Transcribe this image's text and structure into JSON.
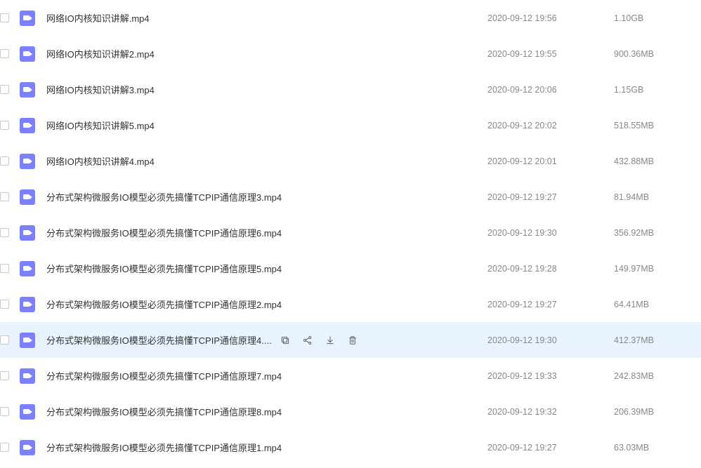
{
  "hovered_index": 9,
  "files": [
    {
      "name": "网络IO内核知识讲解.mp4",
      "date": "2020-09-12 19:56",
      "size": "1.10GB"
    },
    {
      "name": "网络IO内核知识讲解2.mp4",
      "date": "2020-09-12 19:55",
      "size": "900.36MB"
    },
    {
      "name": "网络IO内核知识讲解3.mp4",
      "date": "2020-09-12 20:06",
      "size": "1.15GB"
    },
    {
      "name": "网络IO内核知识讲解5.mp4",
      "date": "2020-09-12 20:02",
      "size": "518.55MB"
    },
    {
      "name": "网络IO内核知识讲解4.mp4",
      "date": "2020-09-12 20:01",
      "size": "432.88MB"
    },
    {
      "name": "分布式架构微服务IO模型必须先搞懂TCPIP通信原理3.mp4",
      "date": "2020-09-12 19:27",
      "size": "81.94MB"
    },
    {
      "name": "分布式架构微服务IO模型必须先搞懂TCPIP通信原理6.mp4",
      "date": "2020-09-12 19:30",
      "size": "356.92MB"
    },
    {
      "name": "分布式架构微服务IO模型必须先搞懂TCPIP通信原理5.mp4",
      "date": "2020-09-12 19:28",
      "size": "149.97MB"
    },
    {
      "name": "分布式架构微服务IO模型必须先搞懂TCPIP通信原理2.mp4",
      "date": "2020-09-12 19:27",
      "size": "64.41MB"
    },
    {
      "name": "分布式架构微服务IO模型必须先搞懂TCPIP通信原理4....",
      "date": "2020-09-12 19:30",
      "size": "412.37MB"
    },
    {
      "name": "分布式架构微服务IO模型必须先搞懂TCPIP通信原理7.mp4",
      "date": "2020-09-12 19:33",
      "size": "242.83MB"
    },
    {
      "name": "分布式架构微服务IO模型必须先搞懂TCPIP通信原理8.mp4",
      "date": "2020-09-12 19:32",
      "size": "206.39MB"
    },
    {
      "name": "分布式架构微服务IO模型必须先搞懂TCPIP通信原理1.mp4",
      "date": "2020-09-12 19:27",
      "size": "63.03MB"
    }
  ],
  "actions": {
    "copy_tooltip": "复制",
    "share_tooltip": "分享",
    "download_tooltip": "下载",
    "delete_tooltip": "删除"
  }
}
